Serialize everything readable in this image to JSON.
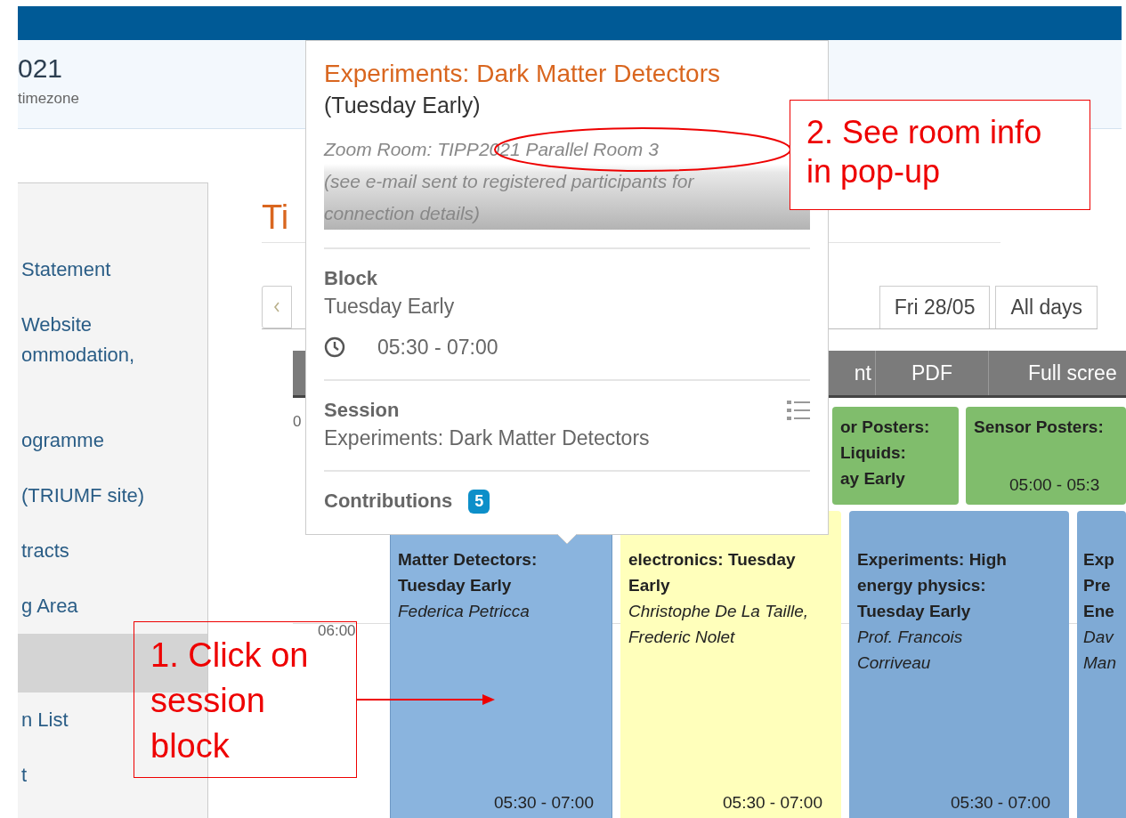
{
  "header": {
    "title": "021",
    "subtitle": "timezone"
  },
  "sidebar": {
    "items": [
      {
        "lines": [
          "Statement"
        ],
        "selected": false
      },
      {
        "lines": [
          "Website",
          "ommodation,"
        ],
        "selected": false
      },
      {
        "lines": [
          "ogramme"
        ],
        "selected": false
      },
      {
        "lines": [
          "(TRIUMF site)"
        ],
        "selected": false
      },
      {
        "lines": [
          "tracts"
        ],
        "selected": false
      },
      {
        "lines": [
          "g Area"
        ],
        "selected": false
      },
      {
        "selected": true
      },
      {
        "lines": [
          "n List"
        ],
        "selected": false
      },
      {
        "lines": [
          "t"
        ],
        "selected": false
      }
    ]
  },
  "page_title": "Ti",
  "day_tabs": [
    {
      "label": "Fri 28/05",
      "selected": false
    },
    {
      "label": "All days",
      "selected": false
    }
  ],
  "toolbar": [
    "nt",
    "PDF",
    "Full scree"
  ],
  "time_labels": [
    "0",
    "06:00"
  ],
  "poster_row": [
    {
      "color": "#80bd6c",
      "title_lines": [
        "or Posters:",
        "Liquids:",
        "ay Early"
      ]
    },
    {
      "color": "#80bd6c",
      "title_lines": [
        "Sensor Posters:"
      ],
      "time": "05:00 - 05:3"
    }
  ],
  "session_row": [
    {
      "color": "#8ab4de",
      "selected": true,
      "title_lines": [
        "Matter Detectors:",
        "Tuesday Early"
      ],
      "speaker_lines": [
        "Federica Petricca"
      ],
      "time": "05:30 - 07:00"
    },
    {
      "color": "#ffffbb",
      "selected": false,
      "title_lines": [
        "electronics: Tuesday",
        "Early"
      ],
      "speaker_lines": [
        "Christophe De La Taille,",
        "Frederic Nolet"
      ],
      "time": "05:30 - 07:00"
    },
    {
      "color": "#7faad5",
      "selected": false,
      "title_lines": [
        "Experiments: High",
        "energy physics:",
        "Tuesday Early"
      ],
      "speaker_lines": [
        "Prof. Francois",
        "Corriveau"
      ],
      "time": "05:30 - 07:00"
    },
    {
      "color": "#7faad5",
      "selected": false,
      "title_lines": [
        "Exp",
        "Pre",
        "Ene"
      ],
      "speaker_lines": [
        "Dav",
        "Man"
      ]
    }
  ],
  "popup": {
    "title": "Experiments: Dark Matter Detectors",
    "subtitle": "(Tuesday Early)",
    "location_lines": [
      "Zoom Room: TIPP2021 Parallel Room 3",
      "(see e-mail sent to registered participants for",
      "connection details)"
    ],
    "block_label": "Block",
    "block_value": "Tuesday Early",
    "time": "05:30 - 07:00",
    "session_label": "Session",
    "session_value": "Experiments: Dark Matter Detectors",
    "contributions_label": "Contributions",
    "contributions_count": "5"
  },
  "annotations": [
    {
      "kind": "callout",
      "text": "2. See room info in pop-up"
    },
    {
      "kind": "callout",
      "text": "1. Click on session block"
    }
  ]
}
